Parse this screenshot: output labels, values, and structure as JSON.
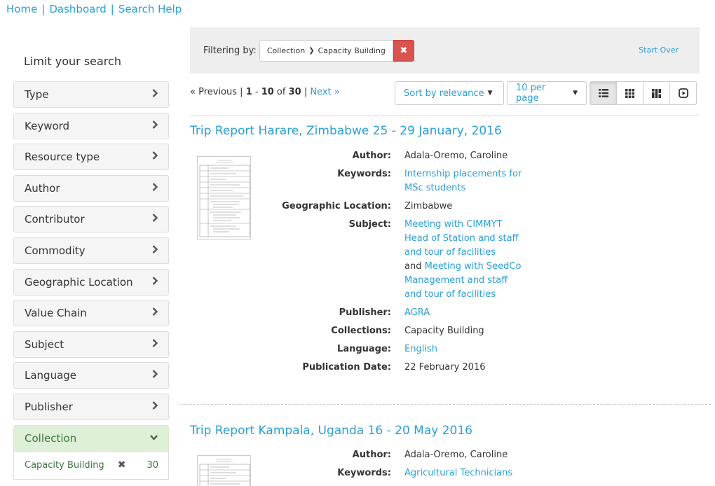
{
  "breadcrumb": {
    "home": "Home",
    "dashboard": "Dashboard",
    "help": "Search Help",
    "sep": "|"
  },
  "sidebar": {
    "heading": "Limit your search",
    "facets": [
      "Type",
      "Keyword",
      "Resource type",
      "Author",
      "Contributor",
      "Commodity",
      "Geographic Location",
      "Value Chain",
      "Subject",
      "Language",
      "Publisher"
    ],
    "open_facet": "Collection",
    "open_value": {
      "label": "Capacity Building",
      "count": "30"
    }
  },
  "constraints": {
    "label": "Filtering by:",
    "field": "Collection",
    "value": "Capacity Building",
    "start_over": "Start Over"
  },
  "pager": {
    "prev": "« Previous",
    "from": "1",
    "dash": " - ",
    "to": "10",
    "of": " of ",
    "total": "30",
    "next": "Next »"
  },
  "sort": {
    "sort_label": "Sort by relevance",
    "per_page": "10 per page"
  },
  "colors": {
    "link": "#2a9fd6",
    "danger": "#d9534f",
    "success_bg": "#dff0d8",
    "success_text": "#3c763d"
  },
  "results": [
    {
      "title": "Trip Report Harare, Zimbabwe 25 - 29 January, 2016",
      "author_label": "Author:",
      "author": "Adala-Oremo, Caroline",
      "keywords_label": "Keywords:",
      "keywords": "Internship placements for MSc students",
      "geo_label": "Geographic Location:",
      "geo": "Zimbabwe",
      "subject_label": "Subject:",
      "subject1": "Meeting with CIMMYT Head of Station and staff and tour of facilities",
      "subject_and": "and",
      "subject2": "Meeting with SeedCo Management and staff and tour of facilities",
      "publisher_label": "Publisher:",
      "publisher": "AGRA",
      "collections_label": "Collections:",
      "collections": "Capacity Building",
      "language_label": "Language:",
      "language": "English",
      "pubdate_label": "Publication Date:",
      "pubdate": "22 February 2016"
    },
    {
      "title": "Trip Report Kampala, Uganda 16 - 20 May 2016",
      "author_label": "Author:",
      "author": "Adala-Oremo, Caroline",
      "keywords_label": "Keywords:",
      "keywords": "Agricultural Technicians"
    }
  ]
}
